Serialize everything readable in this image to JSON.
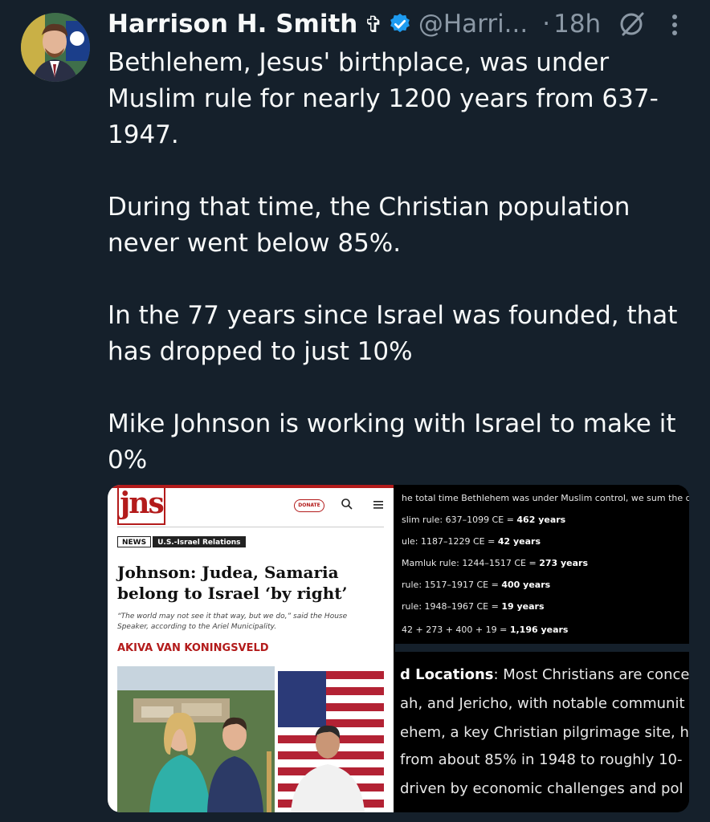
{
  "tweet": {
    "author_name": "Harrison H. Smith",
    "handle": "@Harri...",
    "separator": "·",
    "time": "18h",
    "text": "Bethlehem, Jesus' birthplace, was under Muslim rule for nearly 1200 years from 637-1947.\n\nDuring that time, the Christian population never went below 85%.\n\nIn the 77 years since Israel was founded, that has dropped to just 10%\n\nMike Johnson is working with Israel to make it 0%",
    "name_emoji": "✞",
    "icons": [
      "verified-badge-icon",
      "grok-icon",
      "more-icon"
    ]
  },
  "article_card": {
    "logo": "jns",
    "donate_label": "DONATE",
    "category": "NEWS",
    "subcategory": "U.S.-Israel Relations",
    "headline": "Johnson: Judea, Samaria belong to Israel ‘by right’",
    "dek": "“The world may not see it that way, but we do,” said the House Speaker, according to the Ariel Municipality.",
    "byline": "AKIVA VAN KONINGSVELD"
  },
  "screenshot_card": {
    "lines": [
      {
        "label": "he total time Bethlehem was under Muslim control, we sum the di",
        "value": ""
      },
      {
        "label": "slim rule: 637–1099 CE = ",
        "value": "462 years"
      },
      {
        "label": "ule: 1187–1229 CE = ",
        "value": "42 years"
      },
      {
        "label": "Mamluk rule: 1244–1517 CE = ",
        "value": "273 years"
      },
      {
        "label": "rule: 1517–1917 CE = ",
        "value": "400 years"
      },
      {
        "label": "rule: 1948–1967 CE = ",
        "value": "19 years"
      },
      {
        "label": "42 + 273 + 400 + 19 = ",
        "value": "1,196 years"
      }
    ],
    "big_heading": "d Locations",
    "big_lines": [
      ": Most Christians are conce",
      "ah, and Jericho, with notable communit",
      "ehem, a key Christian pilgrimage site, h",
      "from about 85% in 1948 to roughly 10-",
      "driven by economic challenges and pol"
    ]
  },
  "colors": {
    "background": "#15202b",
    "text": "#f7f9f9",
    "muted": "#8b98a5",
    "verified": "#1d9bf0",
    "jns_red": "#b31b1b"
  }
}
